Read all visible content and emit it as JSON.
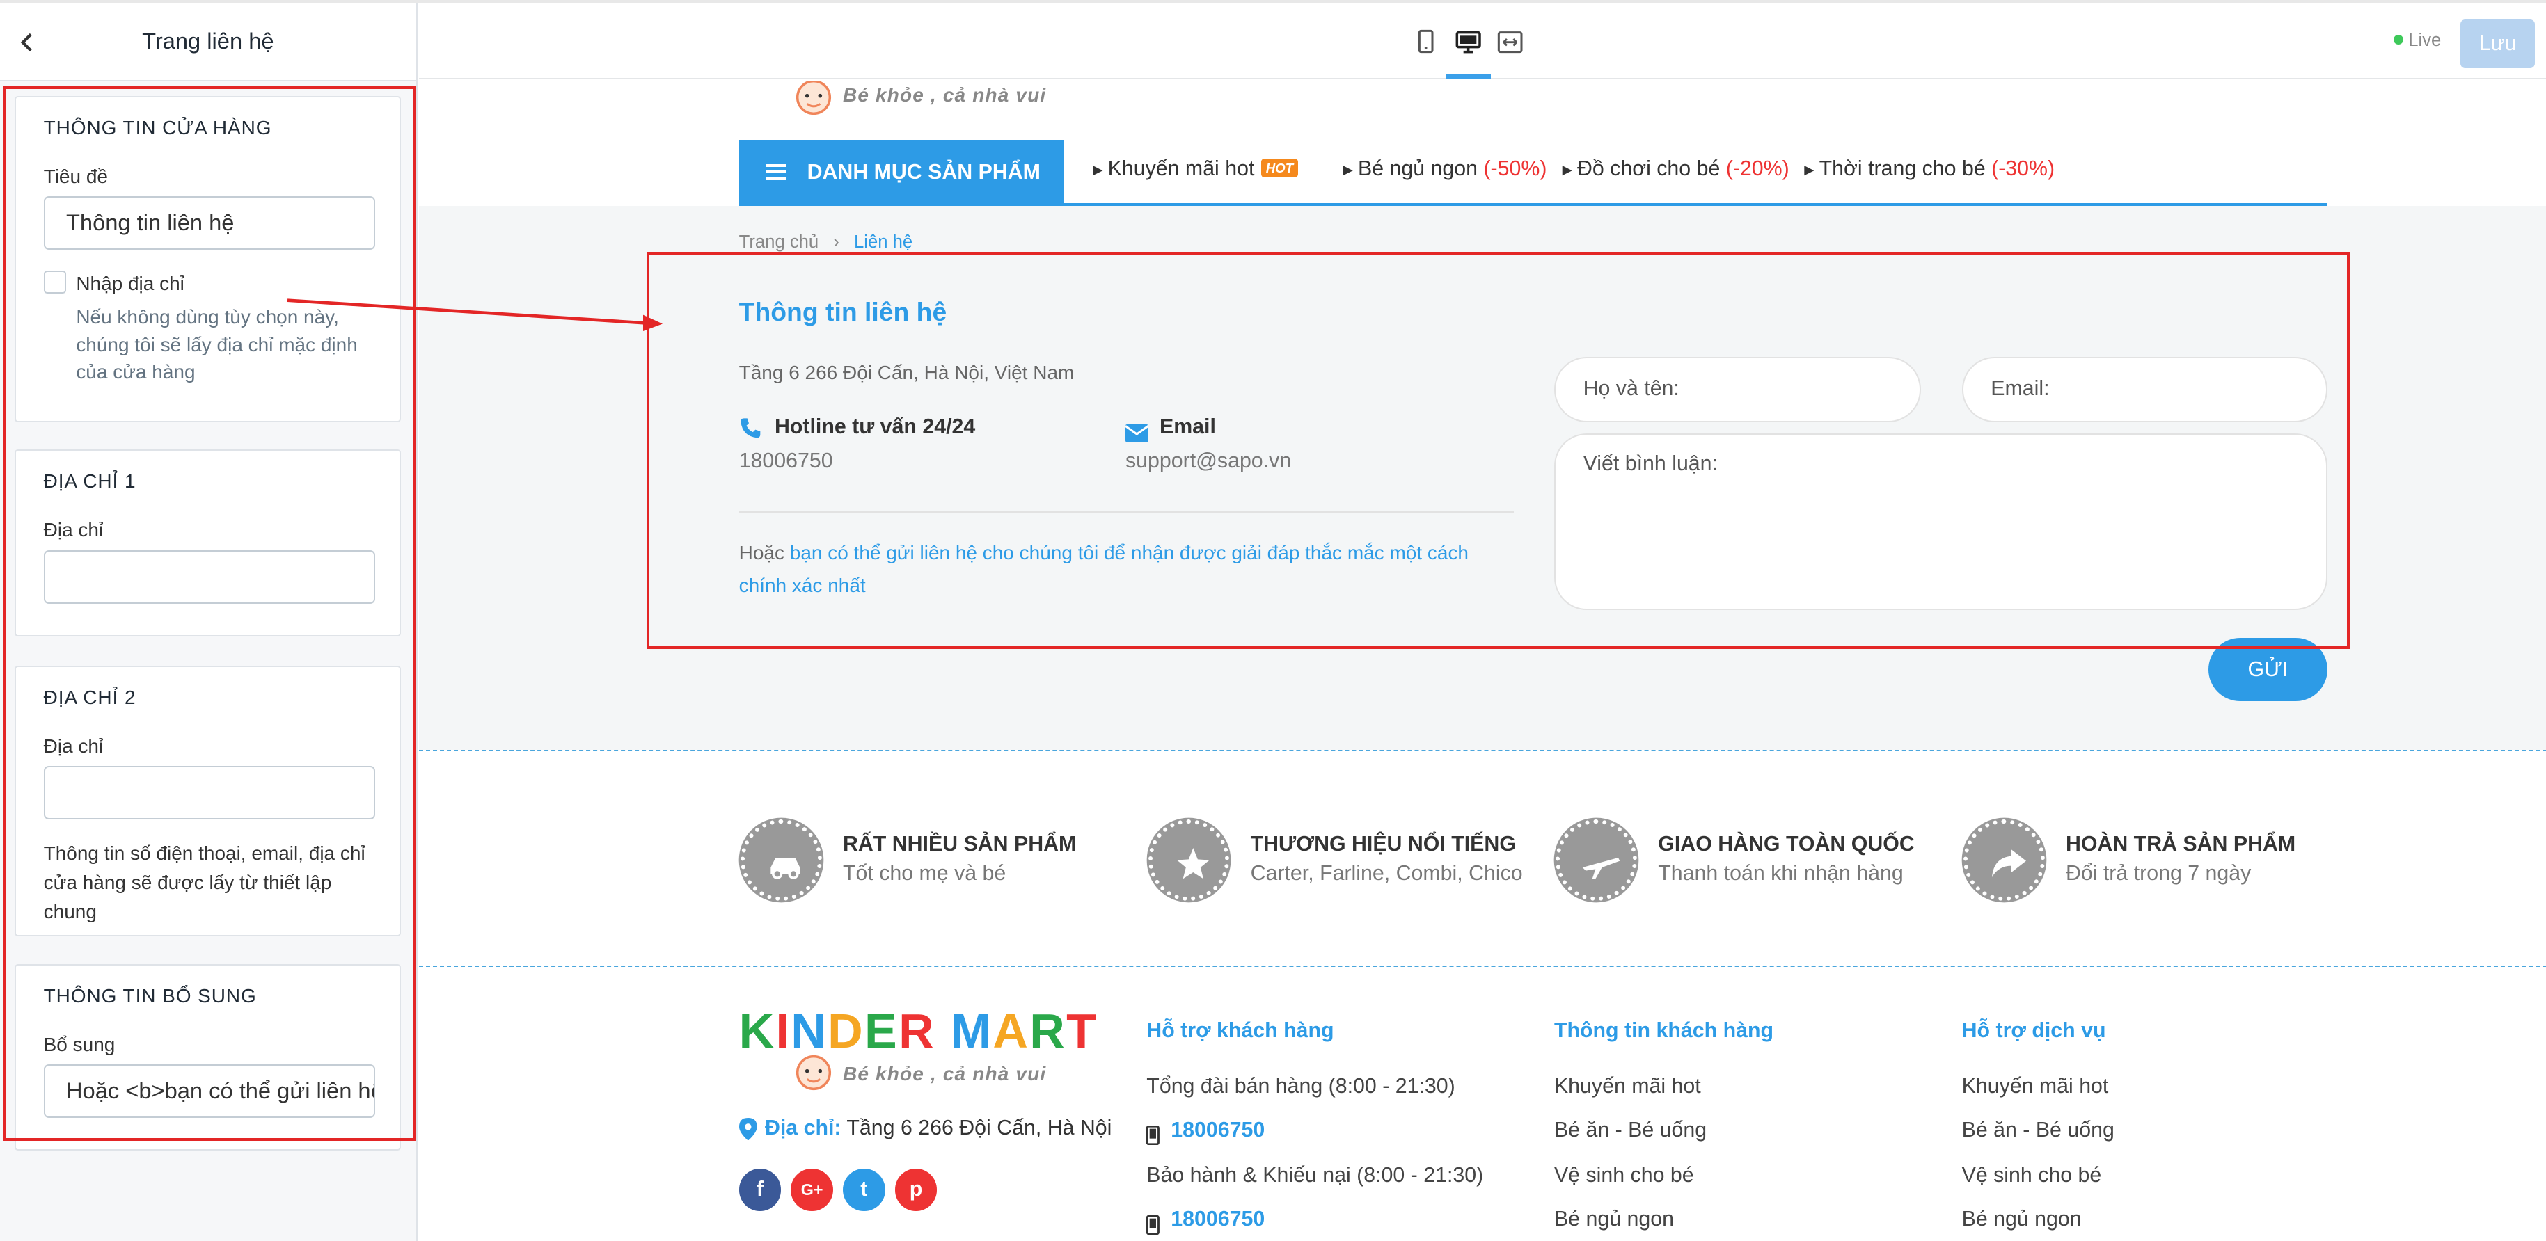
{
  "sidebar": {
    "title": "Trang liên hệ",
    "sections": [
      {
        "heading": "THÔNG TIN CỬA HÀNG",
        "title_label": "Tiêu đề",
        "title_value": "Thông tin liên hệ",
        "checkbox_label": "Nhập địa chỉ",
        "checkbox_note": "Nếu không dùng tùy chọn này, chúng tôi sẽ lấy địa chỉ mặc định của cửa hàng"
      },
      {
        "heading": "ĐỊA CHỈ 1",
        "label": "Địa chỉ",
        "value": ""
      },
      {
        "heading": "ĐỊA CHỈ 2",
        "label": "Địa chỉ",
        "value": "",
        "note": "Thông tin số điện thoại, email, địa chỉ cửa hàng sẽ được lấy từ thiết lập chung"
      },
      {
        "heading": "THÔNG TIN BỔ SUNG",
        "label": "Bổ sung",
        "value": "Hoặc <b>bạn có thể gửi liên hệ cho chúng tôi"
      }
    ]
  },
  "topbar": {
    "live_label": "Live",
    "save_label": "Lưu",
    "live_color": "#3ec95a"
  },
  "preview": {
    "slogan": "Bé khỏe , cả nhà vui",
    "menu_label": "DANH MỤC SẢN PHẨM",
    "nav": [
      {
        "text": "Khuyến mãi hot",
        "badge": "HOT"
      },
      {
        "text": "Bé ngủ ngon ",
        "discount": "(-50%)"
      },
      {
        "text": "Đồ chơi cho bé ",
        "discount": "(-20%)"
      },
      {
        "text": "Thời trang cho bé ",
        "discount": "(-30%)"
      }
    ],
    "breadcrumb": {
      "home": "Trang chủ",
      "current": "Liên hệ"
    },
    "contact": {
      "title": "Thông tin liên hệ",
      "address": "Tầng 6 266 Đội Cấn, Hà Nội, Việt Nam",
      "hotline_label": "Hotline tư vấn 24/24",
      "hotline": "18006750",
      "email_label": "Email",
      "email": "support@sapo.vn",
      "extra_prefix": "Hoặc ",
      "extra_link": "bạn có thể gửi liên hệ cho chúng tôi để nhận được giải đáp thắc mắc một cách chính xác nhất"
    },
    "form": {
      "name_placeholder": "Họ và tên:",
      "email_placeholder": "Email:",
      "comment_placeholder": "Viết bình luận:",
      "submit_label": "GỬI"
    },
    "features": [
      {
        "title": "RẤT NHIỀU SẢN PHẨM",
        "sub": "Tốt cho mẹ và bé",
        "icon": "car-icon"
      },
      {
        "title": "THƯƠNG HIỆU NỔI TIẾNG",
        "sub": "Carter, Farline, Combi, Chico",
        "icon": "star-icon"
      },
      {
        "title": "GIAO HÀNG TOÀN QUỐC",
        "sub": "Thanh toán khi nhận hàng",
        "icon": "plane-icon"
      },
      {
        "title": "HOÀN TRẢ SẢN PHẨM",
        "sub": "Đổi trả trong 7 ngày",
        "icon": "share-arrow-icon"
      }
    ],
    "footer": {
      "logo_text": "KINDER MART",
      "slogan": "Bé khỏe , cả nhà vui",
      "address_label": "Địa chỉ:",
      "address": "Tầng 6 266 Đội Cấn, Hà Nội",
      "col1": {
        "heading": "Hỗ trợ khách hàng",
        "items": [
          "Tổng đài bán hàng (8:00 - 21:30)",
          "18006750",
          "Bảo hành & Khiếu nại (8:00 - 21:30)",
          "18006750"
        ]
      },
      "col2": {
        "heading": "Thông tin khách hàng",
        "items": [
          "Khuyến mãi hot",
          "Bé ăn - Bé uống",
          "Vệ sinh cho bé",
          "Bé ngủ ngon"
        ]
      },
      "col3": {
        "heading": "Hỗ trợ dịch vụ",
        "items": [
          "Khuyến mãi hot",
          "Bé ăn - Bé uống",
          "Vệ sinh cho bé",
          "Bé ngủ ngon"
        ]
      },
      "social": [
        "f",
        "G+",
        "t",
        "p"
      ]
    }
  }
}
